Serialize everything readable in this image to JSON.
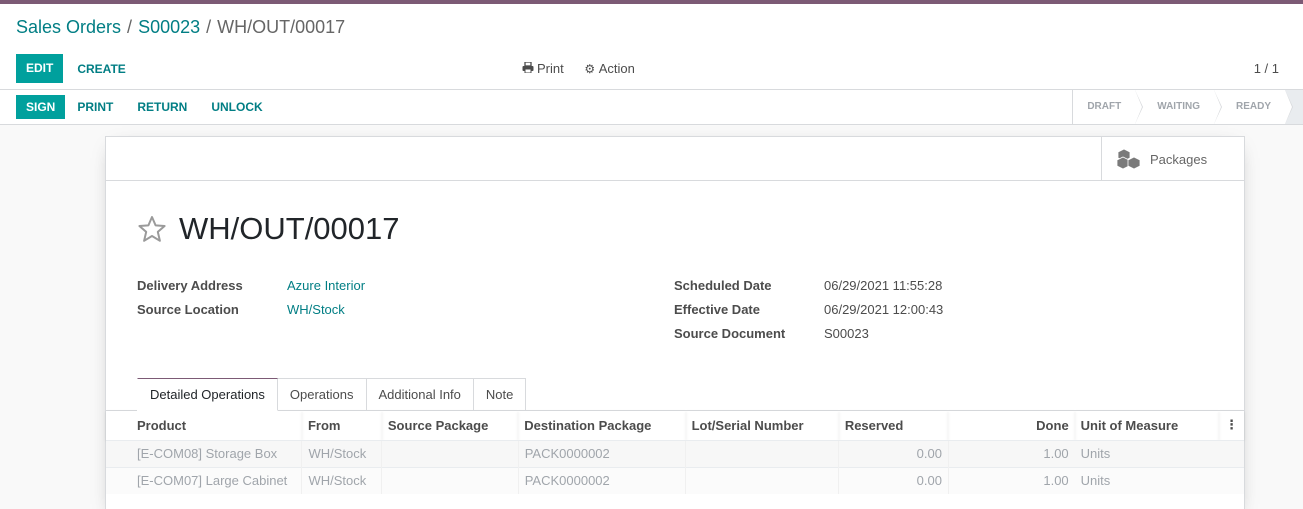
{
  "topbar_color": "#7c5a75",
  "accent_color": "#00a09d",
  "breadcrumb": [
    {
      "label": "Sales Orders",
      "link": true
    },
    {
      "label": "S00023",
      "link": true
    },
    {
      "label": "WH/OUT/00017",
      "link": false
    }
  ],
  "breadcrumb_separator": "/",
  "control_panel": {
    "edit_label": "EDIT",
    "create_label": "CREATE",
    "print_label": "Print",
    "print_icon": "printer-icon",
    "action_label": "Action",
    "action_icon": "gear-icon",
    "pager": "1 / 1"
  },
  "statusbar": {
    "buttons": [
      "SIGN",
      "PRINT",
      "RETURN",
      "UNLOCK"
    ],
    "stages": [
      "DRAFT",
      "WAITING",
      "READY"
    ]
  },
  "smart_buttons": {
    "packages_label": "Packages",
    "packages_icon": "cubes-icon"
  },
  "record": {
    "title": "WH/OUT/00017",
    "favorite_icon": "star-outline-icon",
    "left_fields": [
      {
        "label": "Delivery Address",
        "value": "Azure Interior"
      },
      {
        "label": "Source Location",
        "value": "WH/Stock"
      }
    ],
    "right_fields": [
      {
        "label": "Scheduled Date",
        "value": "06/29/2021 11:55:28"
      },
      {
        "label": "Effective Date",
        "value": "06/29/2021 12:00:43"
      },
      {
        "label": "Source Document",
        "value": "S00023"
      }
    ]
  },
  "tabs": [
    {
      "label": "Detailed Operations",
      "active": true
    },
    {
      "label": "Operations",
      "active": false
    },
    {
      "label": "Additional Info",
      "active": false
    },
    {
      "label": "Note",
      "active": false
    }
  ],
  "table": {
    "columns": [
      "Product",
      "From",
      "Source Package",
      "Destination Package",
      "Lot/Serial Number",
      "Reserved",
      "Done",
      "Unit of Measure"
    ],
    "rows": [
      [
        "[E-COM08] Storage Box",
        "WH/Stock",
        "",
        "PACK0000002",
        "",
        "0.00",
        "1.00",
        "Units"
      ],
      [
        "[E-COM07] Large Cabinet",
        "WH/Stock",
        "",
        "PACK0000002",
        "",
        "0.00",
        "1.00",
        "Units"
      ]
    ]
  }
}
